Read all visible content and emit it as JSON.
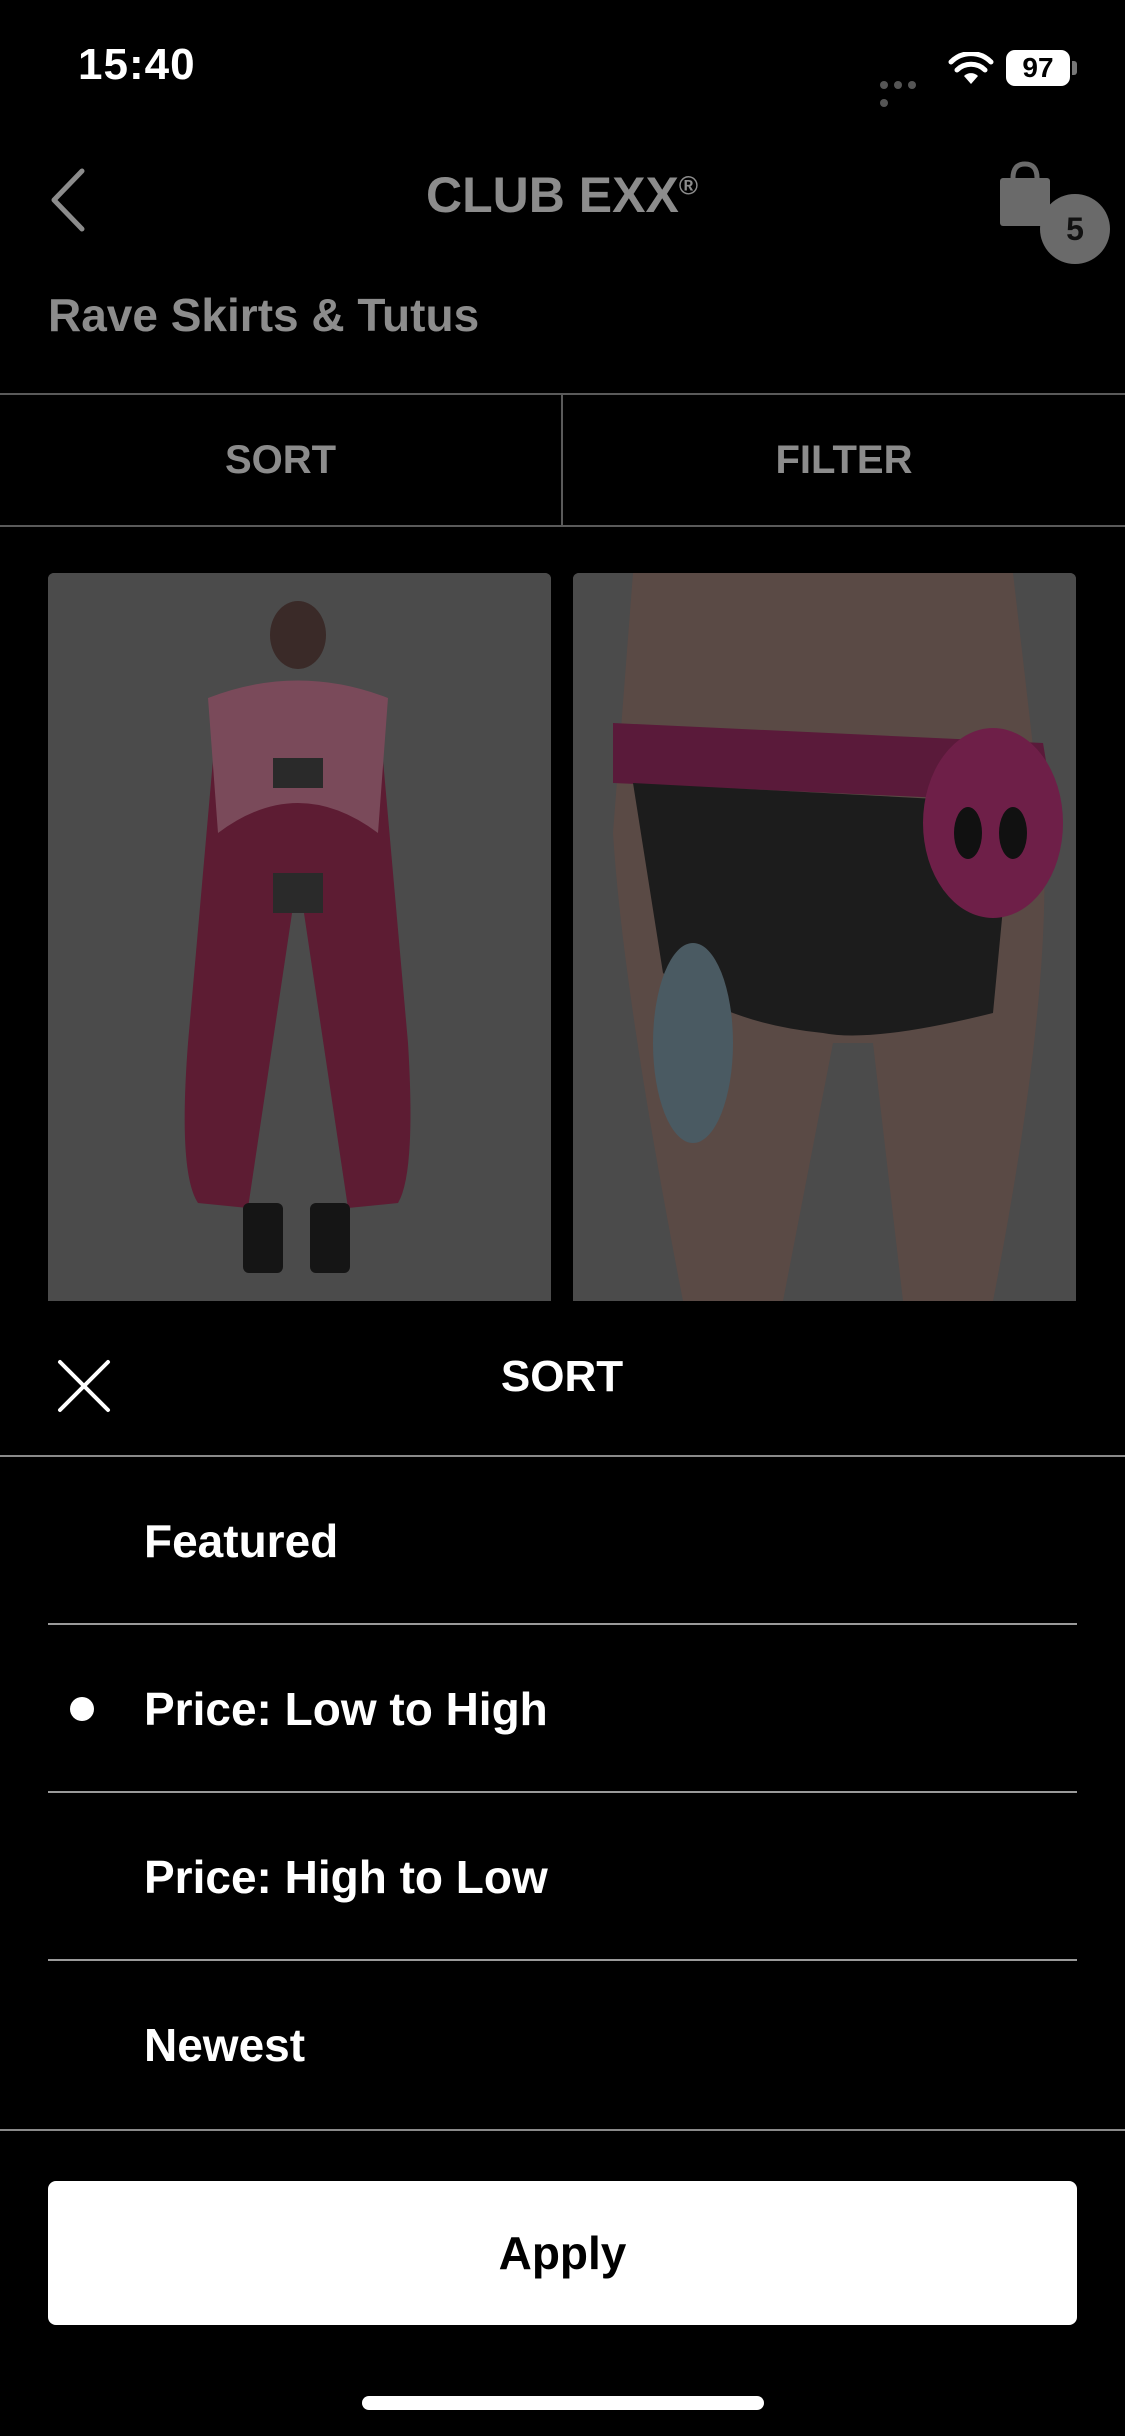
{
  "status_bar": {
    "time": "15:40",
    "battery": "97",
    "icons": [
      "signal-dots-icon",
      "wifi-icon",
      "battery-icon"
    ]
  },
  "nav": {
    "back_icon": "chevron-left-icon",
    "brand": "CLUB EXX",
    "brand_mark": "®",
    "cart_icon": "shopping-bag-icon",
    "cart_count": "5"
  },
  "category": {
    "title": "Rave Skirts & Tutus"
  },
  "tabs": {
    "sort_label": "SORT",
    "filter_label": "FILTER"
  },
  "products": [
    {
      "image": "model-in-pink-fur-coat"
    },
    {
      "image": "pink-belt-with-alien-bag"
    }
  ],
  "sort_sheet": {
    "title": "SORT",
    "close_icon": "close-icon",
    "options": [
      {
        "label": "Featured",
        "selected": false
      },
      {
        "label": "Price: Low to High",
        "selected": true
      },
      {
        "label": "Price: High to Low",
        "selected": false
      },
      {
        "label": "Newest",
        "selected": false
      }
    ],
    "apply_label": "Apply"
  },
  "colors": {
    "background": "#000000",
    "overlay_text": "#8c8c8c",
    "sheet_text": "#ffffff",
    "button_bg": "#ffffff",
    "fur_pink": "#b0184f"
  }
}
